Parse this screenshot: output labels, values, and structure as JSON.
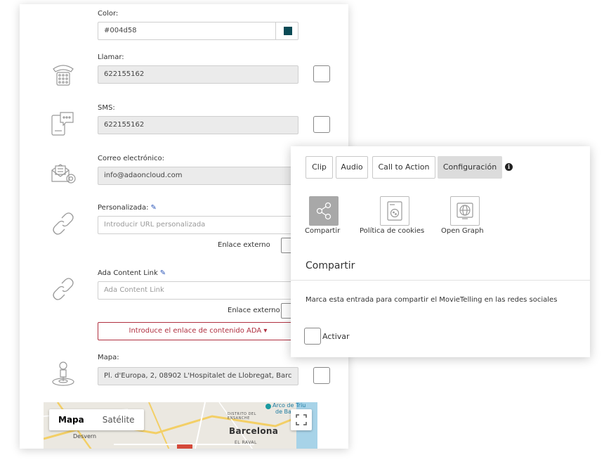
{
  "form": {
    "color": {
      "label": "Color:",
      "value": "#004d58",
      "swatch": "#0b4a55"
    },
    "call": {
      "label": "Llamar:",
      "value": "622155162"
    },
    "sms": {
      "label": "SMS:",
      "value": "622155162"
    },
    "email": {
      "label": "Correo electrónico:",
      "value": "info@adaoncloud.com"
    },
    "custom": {
      "label": "Personalizada:",
      "placeholder": "Introducir URL personalizada",
      "external": "Enlace externo"
    },
    "ada": {
      "label": "Ada Content Link",
      "placeholder": "Ada Content Link",
      "external": "Enlace externo",
      "button": "Introduce el enlace de contenido ADA ▾"
    },
    "map_field": {
      "label": "Mapa:",
      "value": "Pl. d'Europa, 2, 08902 L'Hospitalet de Llobregat, Barc"
    }
  },
  "map": {
    "mode_map": "Mapa",
    "mode_sat": "Satélite",
    "city": "Barcelona",
    "district": "DISTRITO DEL\nENSANCHE",
    "raval": "EL RAVAL",
    "arc": "Arco de Triu",
    "arc2": "de Ba",
    "desvern": "Desvern"
  },
  "panel": {
    "tabs": [
      "Clip",
      "Audio",
      "Call to Action",
      "Configuración"
    ],
    "options": [
      "Compartir",
      "Política de cookies",
      "Open Graph"
    ],
    "section_title": "Compartir",
    "description": "Marca esta entrada para compartir el MovieTelling en las redes sociales",
    "activate": "Activar"
  },
  "colors": {
    "accent_red": "#b03040",
    "link_blue": "#2a55b8"
  }
}
